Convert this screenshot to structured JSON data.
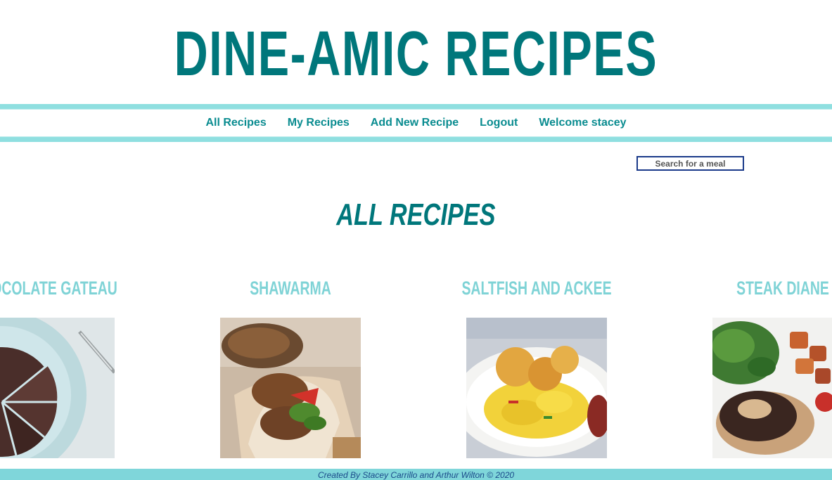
{
  "site": {
    "title": "DINE-AMIC RECIPES"
  },
  "nav": {
    "items": [
      "All Recipes",
      "My Recipes",
      "Add New Recipe",
      "Logout",
      "Welcome stacey"
    ]
  },
  "search": {
    "placeholder": "Search for a meal"
  },
  "page": {
    "heading": "ALL RECIPES"
  },
  "recipes": [
    {
      "title": "CHOCOLATE GATEAU"
    },
    {
      "title": "SHAWARMA"
    },
    {
      "title": "SALTFISH AND ACKEE"
    },
    {
      "title": "STEAK DIANE"
    }
  ],
  "footer": {
    "text": "Created By Stacey Carrillo and Arthur Wilton © 2020"
  },
  "colors": {
    "brand": "#00777b",
    "nav_band": "#8fdfe0",
    "card_title": "#7fd3d6",
    "footer": "#7fd6da"
  }
}
